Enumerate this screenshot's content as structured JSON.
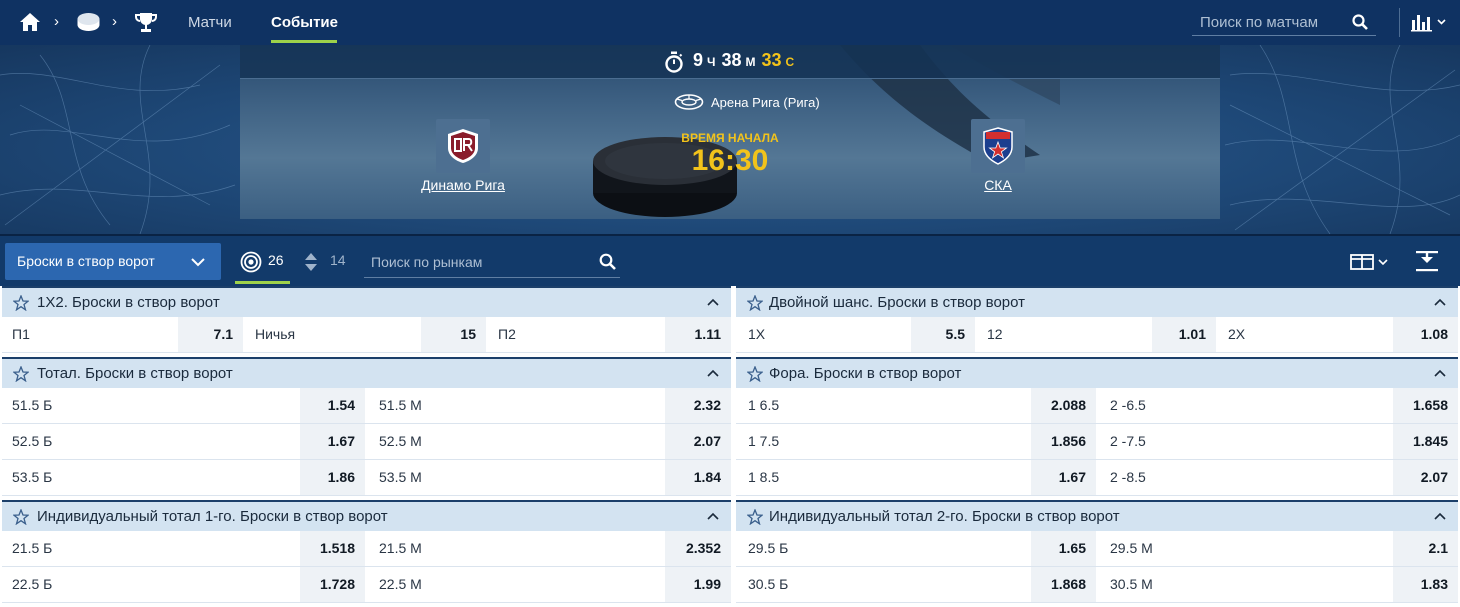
{
  "nav": {
    "links": {
      "matches": "Матчи",
      "event": "Событие"
    },
    "search_placeholder": "Поиск по матчам",
    "accent": "#9ed24a"
  },
  "event": {
    "countdown": {
      "hours": "9",
      "hours_unit": "Ч",
      "minutes": "38",
      "minutes_unit": "М",
      "seconds": "33",
      "seconds_unit": "С"
    },
    "arena": "Арена Рига (Рига)",
    "start_label": "ВРЕМЯ НАЧАЛА",
    "start_time": "16:30",
    "home_team": "Динамо Рига",
    "away_team": "СКА",
    "accent": "#f2c31b"
  },
  "filter": {
    "market_group": "Броски в створ ворот",
    "count_all": "26",
    "count_sort": "14",
    "search_placeholder": "Поиск по рынкам"
  },
  "markets": {
    "m1x2": {
      "title": "1X2. Броски в створ ворот",
      "rows": [
        [
          {
            "label": "П1",
            "odd": "7.1"
          },
          {
            "label": "Ничья",
            "odd": "15"
          },
          {
            "label": "П2",
            "odd": "1.11"
          }
        ]
      ]
    },
    "double_chance": {
      "title": "Двойной шанс. Броски в створ ворот",
      "rows": [
        [
          {
            "label": "1X",
            "odd": "5.5"
          },
          {
            "label": "12",
            "odd": "1.01"
          },
          {
            "label": "2X",
            "odd": "1.08"
          }
        ]
      ]
    },
    "total": {
      "title": "Тотал. Броски в створ ворот",
      "rows": [
        [
          {
            "label": "51.5 Б",
            "odd": "1.54"
          },
          {
            "label": "51.5 М",
            "odd": "2.32"
          }
        ],
        [
          {
            "label": "52.5 Б",
            "odd": "1.67"
          },
          {
            "label": "52.5 М",
            "odd": "2.07"
          }
        ],
        [
          {
            "label": "53.5 Б",
            "odd": "1.86"
          },
          {
            "label": "53.5 М",
            "odd": "1.84"
          }
        ]
      ]
    },
    "handicap": {
      "title": "Фора. Броски в створ ворот",
      "rows": [
        [
          {
            "label": "1 6.5",
            "odd": "2.088"
          },
          {
            "label": "2 -6.5",
            "odd": "1.658"
          }
        ],
        [
          {
            "label": "1 7.5",
            "odd": "1.856"
          },
          {
            "label": "2 -7.5",
            "odd": "1.845"
          }
        ],
        [
          {
            "label": "1 8.5",
            "odd": "1.67"
          },
          {
            "label": "2 -8.5",
            "odd": "2.07"
          }
        ]
      ]
    },
    "ind_total_1": {
      "title": "Индивидуальный тотал 1-го. Броски в створ ворот",
      "rows": [
        [
          {
            "label": "21.5 Б",
            "odd": "1.518"
          },
          {
            "label": "21.5 М",
            "odd": "2.352"
          }
        ],
        [
          {
            "label": "22.5 Б",
            "odd": "1.728"
          },
          {
            "label": "22.5 М",
            "odd": "1.99"
          }
        ]
      ]
    },
    "ind_total_2": {
      "title": "Индивидуальный тотал 2-го. Броски в створ ворот",
      "rows": [
        [
          {
            "label": "29.5 Б",
            "odd": "1.65"
          },
          {
            "label": "29.5 М",
            "odd": "2.1"
          }
        ],
        [
          {
            "label": "30.5 Б",
            "odd": "1.868"
          },
          {
            "label": "30.5 М",
            "odd": "1.83"
          }
        ]
      ]
    }
  }
}
